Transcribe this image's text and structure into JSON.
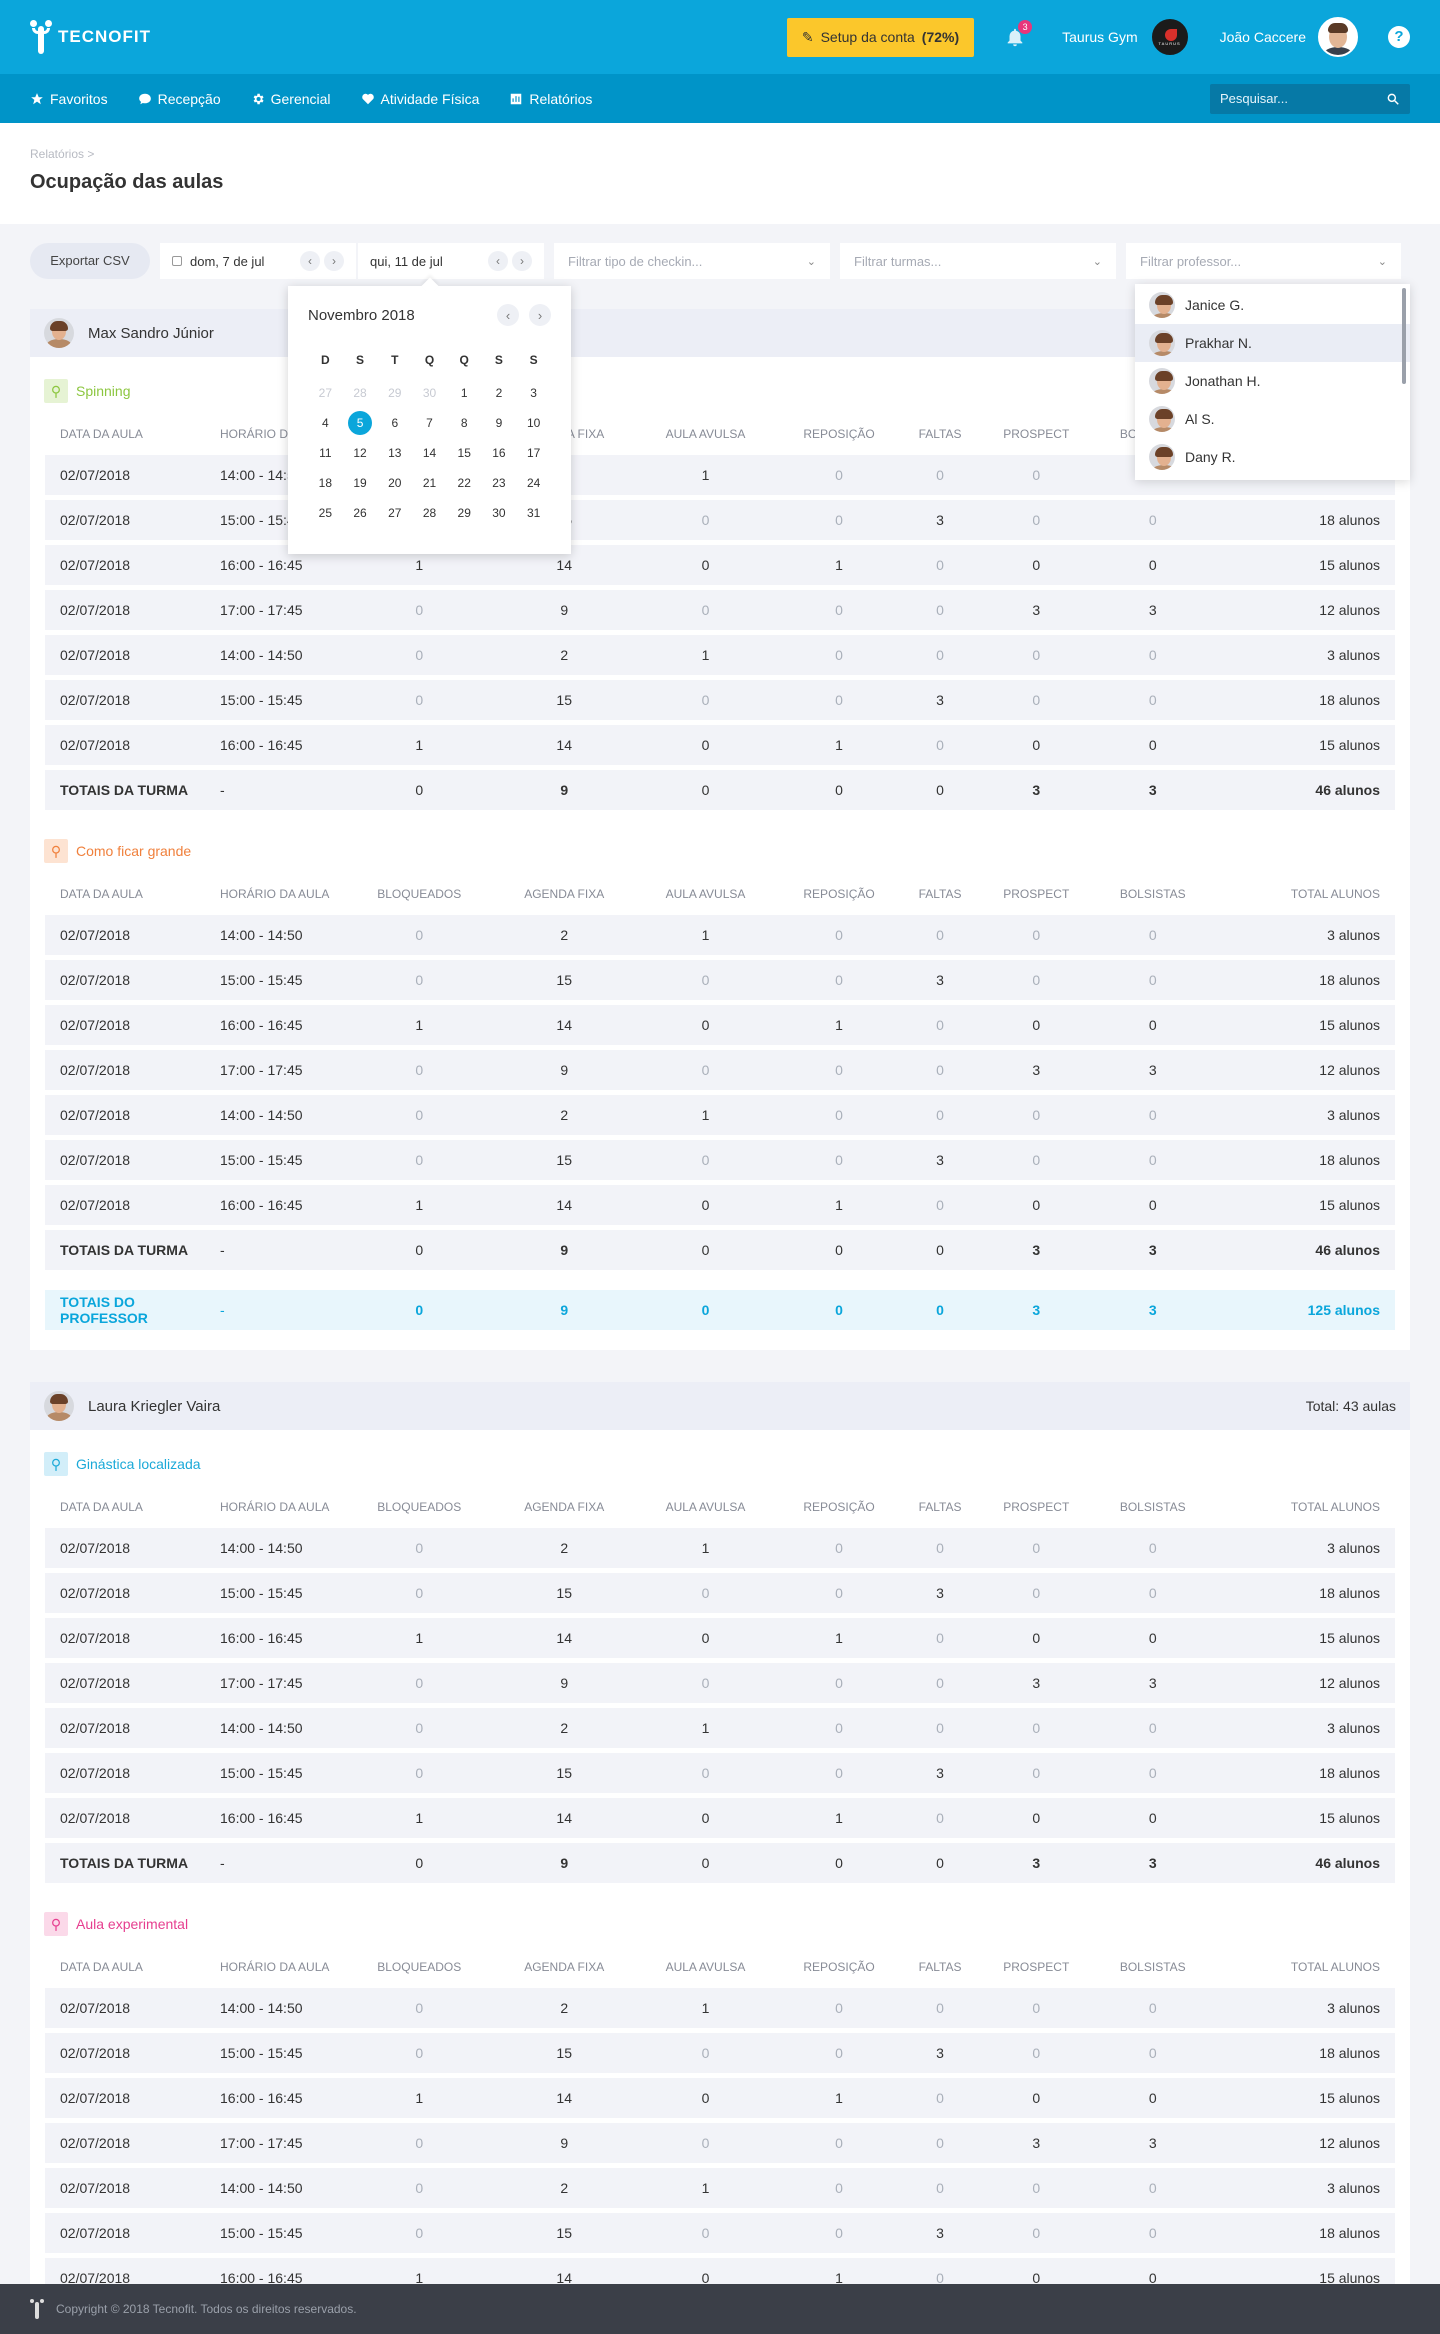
{
  "header": {
    "brand": "TECNOFIT",
    "setup_label": "Setup da conta",
    "setup_percent": "(72%)",
    "notifications_count": "3",
    "gym_name": "Taurus Gym",
    "user_name": "João Caccere",
    "help": "?"
  },
  "nav": {
    "items": [
      "Favoritos",
      "Recepção",
      "Gerencial",
      "Atividade Física",
      "Relatórios"
    ],
    "search_placeholder": "Pesquisar..."
  },
  "page": {
    "breadcrumb": "Relatórios >",
    "title": "Ocupação das aulas"
  },
  "filters": {
    "export": "Exportar CSV",
    "date_from": "dom, 7 de jul",
    "date_to": "qui, 11 de jul",
    "checkin_placeholder": "Filtrar tipo de checkin...",
    "class_placeholder": "Filtrar turmas...",
    "teacher_placeholder": "Filtrar professor..."
  },
  "calendar": {
    "month": "Novembro 2018",
    "weekdays": [
      "D",
      "S",
      "T",
      "Q",
      "Q",
      "S",
      "S"
    ],
    "days": [
      [
        "27",
        "off"
      ],
      [
        "28",
        "off"
      ],
      [
        "29",
        "off"
      ],
      [
        "30",
        "off"
      ],
      [
        "1",
        ""
      ],
      [
        "2",
        ""
      ],
      [
        "3",
        ""
      ],
      [
        "4",
        ""
      ],
      [
        "5",
        "today"
      ],
      [
        "6",
        ""
      ],
      [
        "7",
        ""
      ],
      [
        "8",
        ""
      ],
      [
        "9",
        ""
      ],
      [
        "10",
        ""
      ],
      [
        "11",
        ""
      ],
      [
        "12",
        ""
      ],
      [
        "13",
        ""
      ],
      [
        "14",
        ""
      ],
      [
        "15",
        ""
      ],
      [
        "16",
        ""
      ],
      [
        "17",
        ""
      ],
      [
        "18",
        ""
      ],
      [
        "19",
        ""
      ],
      [
        "20",
        ""
      ],
      [
        "21",
        ""
      ],
      [
        "22",
        ""
      ],
      [
        "23",
        ""
      ],
      [
        "24",
        ""
      ],
      [
        "25",
        ""
      ],
      [
        "26",
        ""
      ],
      [
        "27",
        ""
      ],
      [
        "28",
        ""
      ],
      [
        "29",
        ""
      ],
      [
        "30",
        ""
      ],
      [
        "31",
        ""
      ]
    ]
  },
  "teachers_dropdown": [
    "Janice G.",
    "Prakhar N.",
    "Jonathan H.",
    "Al S.",
    "Dany R."
  ],
  "columns": [
    "Data da aula",
    "Horário da aula",
    "Bloqueados",
    "Agenda fixa",
    "Aula avulsa",
    "Reposição",
    "Faltas",
    "Prospect",
    "Bolsistas",
    "Total alunos"
  ],
  "rows_template": [
    [
      "02/07/2018",
      "14:00 - 14:50",
      "0",
      "2",
      "1",
      "0",
      "0",
      "0",
      "0",
      "3 alunos"
    ],
    [
      "02/07/2018",
      "15:00 - 15:45",
      "0",
      "15",
      "0",
      "0",
      "3",
      "0",
      "0",
      "18 alunos"
    ],
    [
      "02/07/2018",
      "16:00 - 16:45",
      "1",
      "14",
      "0",
      "1",
      "0",
      "0",
      "0",
      "15 alunos"
    ],
    [
      "02/07/2018",
      "17:00 - 17:45",
      "0",
      "9",
      "0",
      "0",
      "0",
      "3",
      "3",
      "12 alunos"
    ],
    [
      "02/07/2018",
      "14:00 - 14:50",
      "0",
      "2",
      "1",
      "0",
      "0",
      "0",
      "0",
      "3 alunos"
    ],
    [
      "02/07/2018",
      "15:00 - 15:45",
      "0",
      "15",
      "0",
      "0",
      "3",
      "0",
      "0",
      "18 alunos"
    ],
    [
      "02/07/2018",
      "16:00 - 16:45",
      "1",
      "14",
      "0",
      "1",
      "0",
      "0",
      "0",
      "15 alunos"
    ]
  ],
  "class_total": [
    "TOTAIS DA TURMA",
    "-",
    "0",
    "9",
    "0",
    "0",
    "0",
    "3",
    "3",
    "46 alunos"
  ],
  "professors": [
    {
      "name": "Max Sandro Júnior",
      "total": "",
      "classes": [
        {
          "name": "Spinning",
          "color": "#8cc63f",
          "bg": "#e6f3d4"
        },
        {
          "name": "Como ficar grande",
          "color": "#f0803c",
          "bg": "#fde3d2"
        }
      ],
      "professor_total": [
        "TOTAIS DO PROFESSOR",
        "-",
        "0",
        "9",
        "0",
        "0",
        "0",
        "3",
        "3",
        "125 alunos"
      ]
    },
    {
      "name": "Laura Kriegler Vaira",
      "total": "Total: 43 aulas",
      "classes": [
        {
          "name": "Ginástica localizada",
          "color": "#1ba9d8",
          "bg": "#d2eef9"
        },
        {
          "name": "Aula experimental",
          "color": "#e63e8f",
          "bg": "#fbd9e9"
        }
      ]
    }
  ],
  "footer": "Copyright © 2018 Tecnofit. Todos os direitos reservados."
}
